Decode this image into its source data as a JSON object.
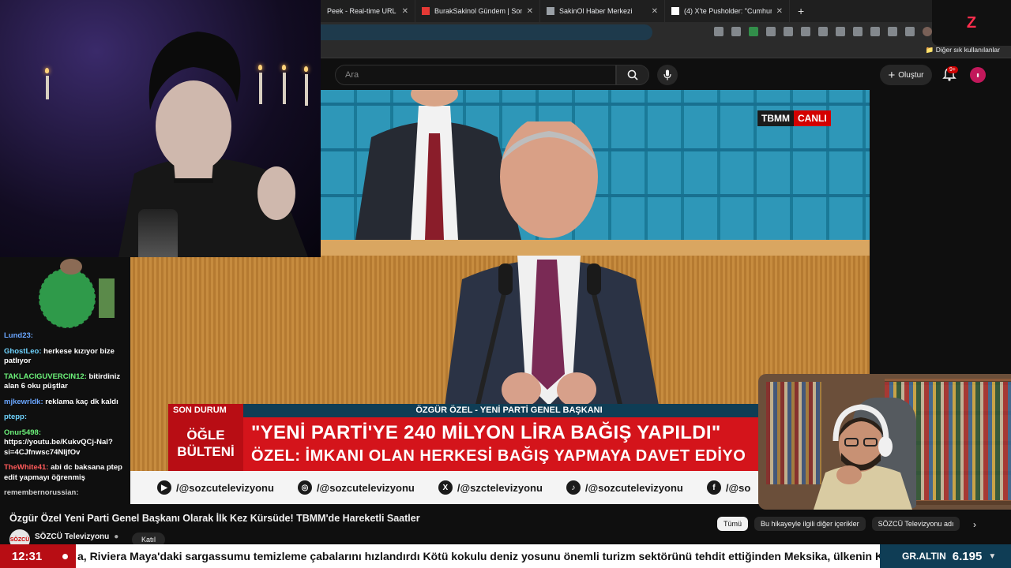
{
  "browser": {
    "tabs": [
      {
        "label": "Peek - Real-time URL Crawler",
        "fav_color": "#f4b400"
      },
      {
        "label": "BurakSakinol Gündem | Son 3 Gün",
        "fav_color": "#e53935"
      },
      {
        "label": "SakinOl Haber Merkezi",
        "fav_color": "#9aa0a6"
      },
      {
        "label": "(4) X'te Pusholder: \"Cumhurbaşkan",
        "fav_color": "#ffffff"
      }
    ],
    "bookmarks_label": "Diğer sık kullanılanlar"
  },
  "youtube": {
    "search_placeholder": "Ara",
    "create_label": "Oluştur",
    "notif_count": "9+",
    "video_title": "Özgür Özel Yeni Parti Genel Başkanı Olarak İlk Kez Kürsüde! TBMM'de Hareketli Saatler",
    "channel_name": "SÖZCÜ Televizyonu",
    "join_label": "Katıl",
    "chips": [
      "Tümü",
      "Bu hikayeyle ilgili diğer içerikler",
      "SÖZCÜ Televizyonu adı"
    ]
  },
  "broadcast": {
    "tbmm": "TBMM",
    "canli": "CANLI",
    "son_dakika": "SON DURUM",
    "name_strip": "ÖZGÜR ÖZEL - YENİ PARTİ GENEL BAŞKANI",
    "bulletin_line1": "ÖĞLE",
    "bulletin_line2": "BÜLTENİ",
    "headline1": "\"YENİ PARTİ'YE 240 MİLYON LİRA BAĞIŞ YAPILDI\"",
    "headline2": "ÖZEL: İMKANI OLAN HERKESİ BAĞIŞ YAPMAYA DAVET EDİYO",
    "socials": [
      {
        "icon": "youtube-icon",
        "glyph": "▶",
        "handle": "/@sozcutelevizyonu"
      },
      {
        "icon": "instagram-icon",
        "glyph": "◎",
        "handle": "/@sozcutelevizyonu"
      },
      {
        "icon": "x-icon",
        "glyph": "X",
        "handle": "/@szctelevizyonu"
      },
      {
        "icon": "tiktok-icon",
        "glyph": "♪",
        "handle": "/@sozcutelevizyonu"
      },
      {
        "icon": "facebook-icon",
        "glyph": "f",
        "handle": "/@so"
      }
    ]
  },
  "chat": {
    "messages": [
      {
        "user": "Lund23:",
        "msg": "",
        "color": "u-blue"
      },
      {
        "user": "GhostLeo:",
        "msg": "herkese kızıyor bize patlıyor",
        "color": "u-cyan"
      },
      {
        "user": "TAKLACIGUVERCIN12:",
        "msg": "bitirdiniz alan 6 oku püştlar",
        "color": "u-green"
      },
      {
        "user": "mjkewrldk:",
        "msg": "reklama kaç dk kaldı",
        "color": "u-blue"
      },
      {
        "user": "ptepp:",
        "msg": "",
        "color": "u-cyan"
      },
      {
        "user": "Onur5498:",
        "msg": "https://youtu.be/KukvQCj-Nal?si=4CJfnwsc74NIjfOv",
        "color": "u-green"
      },
      {
        "user": "TheWhite41:",
        "msg": "abi dc baksana ptep edit yapmayı öğrenmiş",
        "color": "u-red"
      },
      {
        "user": "remembernorussian:",
        "msg": "",
        "color": "u-grey"
      }
    ]
  },
  "ticker": {
    "time": "12:31",
    "text": "a, Riviera Maya'daki sargassumu temizleme çabalarını hızlandırdı Kötü kokulu deniz yosunu önemli turizm sektörünü tehdit ettiğinden Meksika, ülkenin Karay",
    "gold_label": "GR.ALTIN",
    "gold_value": "6.195",
    "gold_arrow": "▼"
  }
}
